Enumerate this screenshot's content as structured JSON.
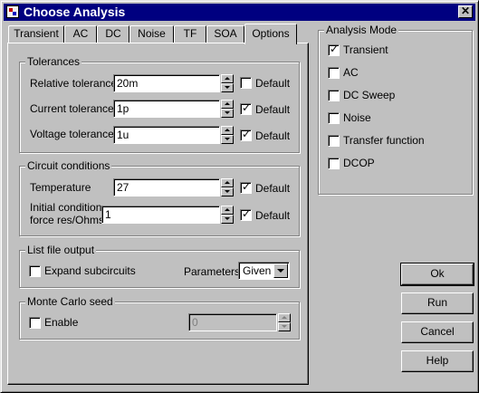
{
  "window": {
    "title": "Choose Analysis",
    "close_glyph": "✕"
  },
  "tabs": [
    {
      "label": "Transient",
      "active": false
    },
    {
      "label": "AC",
      "active": false
    },
    {
      "label": "DC",
      "active": false
    },
    {
      "label": "Noise",
      "active": false
    },
    {
      "label": "TF",
      "active": false
    },
    {
      "label": "SOA",
      "active": false
    },
    {
      "label": "Options",
      "active": true
    }
  ],
  "tolerances": {
    "legend": "Tolerances",
    "relative": {
      "label": "Relative tolerance",
      "value": "20m",
      "default_label": "Default",
      "default_checked": false
    },
    "current": {
      "label": "Current tolerance",
      "value": "1p",
      "default_label": "Default",
      "default_checked": true
    },
    "voltage": {
      "label": "Voltage tolerance",
      "value": "1u",
      "default_label": "Default",
      "default_checked": true
    }
  },
  "circuit": {
    "legend": "Circuit conditions",
    "temperature": {
      "label": "Temperature",
      "value": "27",
      "default_label": "Default",
      "default_checked": true
    },
    "initial": {
      "label_line1": "Initial condition",
      "label_line2": "force res/Ohms",
      "value": "1",
      "default_label": "Default",
      "default_checked": true
    }
  },
  "listfile": {
    "legend": "List file output",
    "expand": {
      "label": "Expand subcircuits",
      "checked": false
    },
    "parameters": {
      "label": "Parameters",
      "selected": "Given"
    }
  },
  "montecarlo": {
    "legend": "Monte Carlo seed",
    "enable": {
      "label": "Enable",
      "checked": false
    },
    "seed_value": "0"
  },
  "analysis_mode": {
    "legend": "Analysis Mode",
    "items": [
      {
        "label": "Transient",
        "checked": true
      },
      {
        "label": "AC",
        "checked": false
      },
      {
        "label": "DC Sweep",
        "checked": false
      },
      {
        "label": "Noise",
        "checked": false
      },
      {
        "label": "Transfer function",
        "checked": false
      },
      {
        "label": "DCOP",
        "checked": false
      }
    ]
  },
  "buttons": {
    "ok": "Ok",
    "run": "Run",
    "cancel": "Cancel",
    "help": "Help"
  }
}
